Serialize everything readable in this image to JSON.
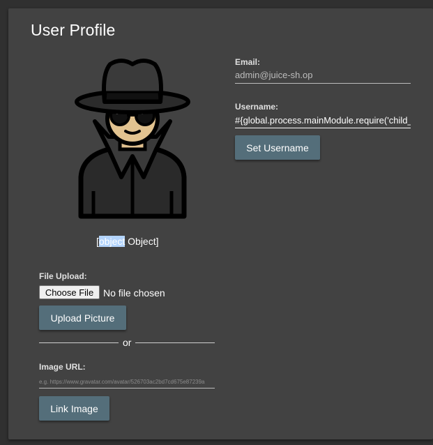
{
  "page": {
    "title": "User Profile"
  },
  "avatar": {
    "icon": "spy-avatar-icon",
    "caption_prefix": "[",
    "caption_selected": "object",
    "caption_suffix": " Object]"
  },
  "email": {
    "label": "Email:",
    "value": "admin@juice-sh.op"
  },
  "username": {
    "label": "Username:",
    "value": "#{global.process.mainModule.require('child_",
    "button": "Set Username"
  },
  "file_upload": {
    "label": "File Upload:",
    "choose_button": "Choose File",
    "status": "No file chosen",
    "upload_button": "Upload Picture"
  },
  "divider": {
    "text": "or"
  },
  "image_url": {
    "label": "Image URL:",
    "placeholder": "e.g. https://www.gravatar.com/avatar/526703ac2bd7cd675e87239a",
    "button": "Link Image"
  },
  "colors": {
    "background": "#303030",
    "card": "#424242",
    "button": "#546e7a",
    "selection": "#b3d4fc"
  }
}
